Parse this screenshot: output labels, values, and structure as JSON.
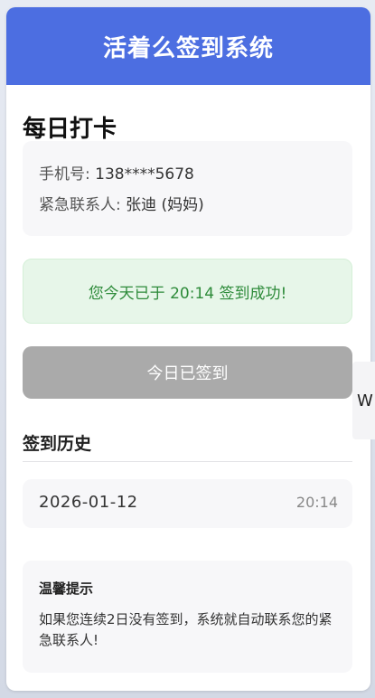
{
  "header": {
    "title": "活着么签到系统"
  },
  "checkin": {
    "section_title": "每日打卡",
    "phone_label": "手机号: ",
    "phone_value": "138****5678",
    "contact_label": "紧急联系人: ",
    "contact_value": "张迪 (妈妈)",
    "success_message": "您今天已于 20:14 签到成功!",
    "button_label": "今日已签到"
  },
  "history": {
    "title": "签到历史",
    "entries": [
      {
        "date": "2026-01-12",
        "time": "20:14"
      }
    ]
  },
  "tips": {
    "title": "温馨提示",
    "body": "如果您连续2日没有签到，系统就自动联系您的紧急联系人!"
  },
  "side_tab": {
    "label": "W"
  },
  "colors": {
    "header_bg": "#4c6ee1",
    "success_bg": "#e7f6e9",
    "success_text": "#2e8b3a",
    "button_disabled": "#aaaaaa"
  }
}
